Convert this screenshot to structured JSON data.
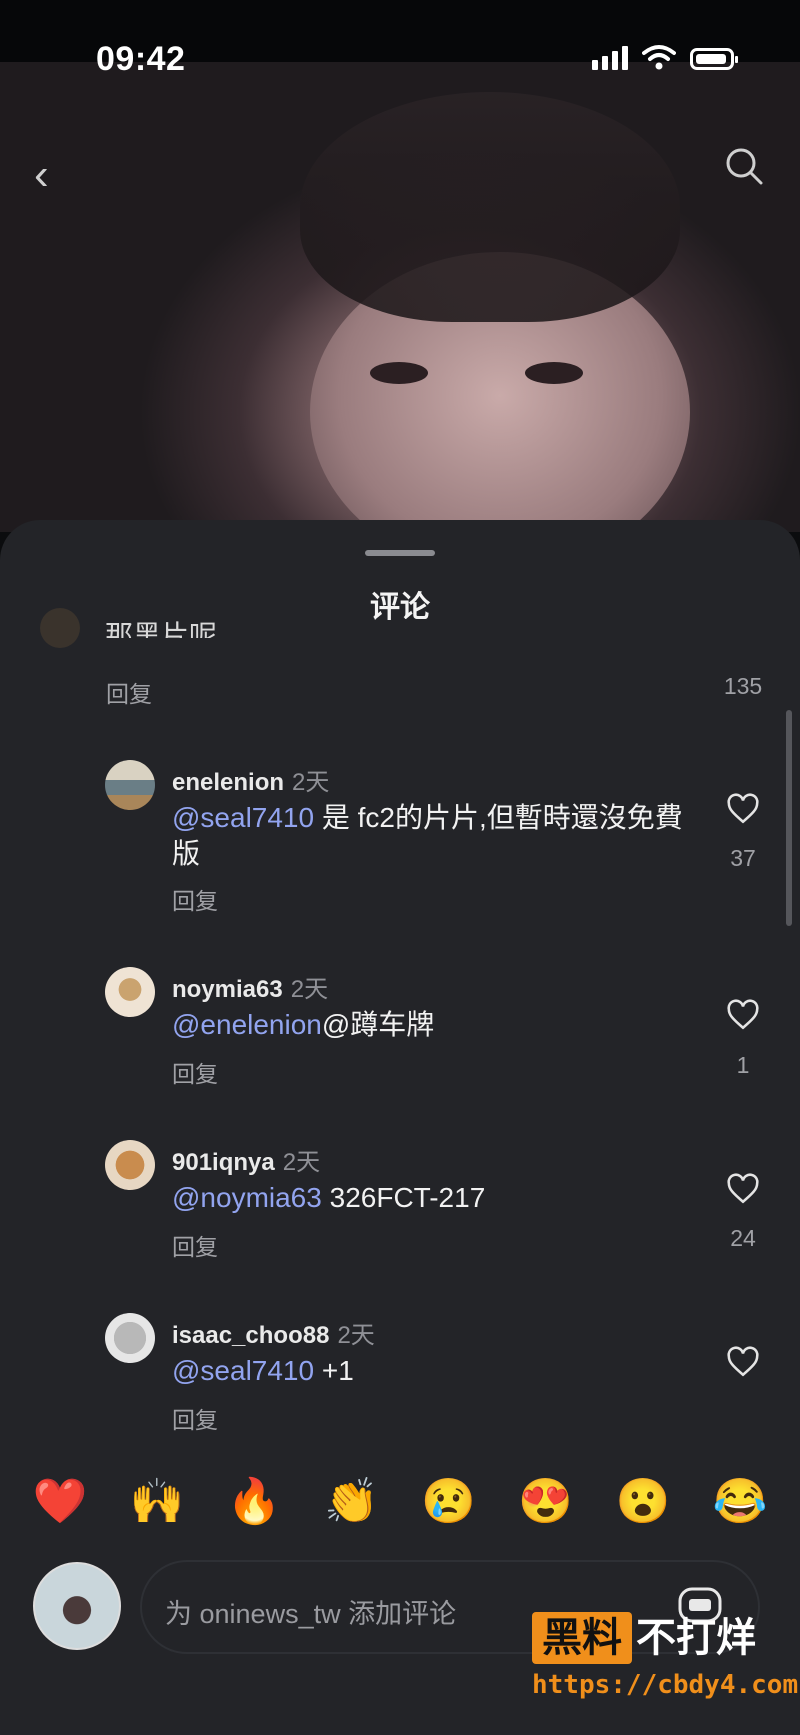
{
  "status_bar": {
    "time": "09:42"
  },
  "sheet": {
    "title": "评论"
  },
  "top_partial_comment": {
    "text": "那黑片呢",
    "reply_label": "回复",
    "likes": "135"
  },
  "comments": [
    {
      "username": "enelenion",
      "time": "2天",
      "mention": "@seal7410",
      "text": " 是 fc2的片片,但暫時還沒免費版",
      "reply_label": "回复",
      "likes": "37"
    },
    {
      "username": "noymia63",
      "time": "2天",
      "mention": "@enelenion",
      "text": "@蹲车牌",
      "reply_label": "回复",
      "likes": "1"
    },
    {
      "username": "901iqnya",
      "time": "2天",
      "mention": "@noymia63",
      "text": " 326FCT-217",
      "reply_label": "回复",
      "likes": "24"
    },
    {
      "username": "isaac_choo88",
      "time": "2天",
      "mention": "@seal7410",
      "text": " +1",
      "reply_label": "回复",
      "likes": ""
    }
  ],
  "emoji_bar": [
    "❤️",
    "🙌",
    "🔥",
    "👏",
    "😢",
    "😍",
    "😮",
    "😂"
  ],
  "composer": {
    "placeholder": "为 oninews_tw 添加评论"
  },
  "watermark": {
    "brand_box": "黑料",
    "brand_text": "不打烊",
    "url": "https://cbdy4.com"
  },
  "colors": {
    "sheet_bg": "#232428",
    "mention": "#92a4ef",
    "watermark": "#f08f1b"
  }
}
